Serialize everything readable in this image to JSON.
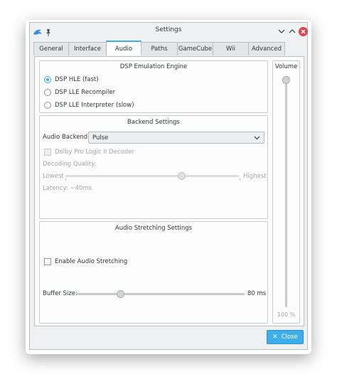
{
  "window": {
    "title": "Settings"
  },
  "tabs": [
    "General",
    "Interface",
    "Audio",
    "Paths",
    "GameCube",
    "Wii",
    "Advanced"
  ],
  "active_tab": "Audio",
  "dsp": {
    "title": "DSP Emulation Engine",
    "options": [
      "DSP HLE (fast)",
      "DSP LLE Recompiler",
      "DSP LLE Interpreter (slow)"
    ],
    "selected": "DSP HLE (fast)"
  },
  "volume": {
    "title": "Volume",
    "value_label": "100 %",
    "value_fraction": 1.0
  },
  "backend": {
    "title": "Backend Settings",
    "audio_backend_label": "Audio Backend:",
    "audio_backend_value": "Pulse",
    "dolby_label": "Dolby Pro Logic II Decoder",
    "decoding_quality_label": "Decoding Quality:",
    "lowest_label": "Lowest",
    "highest_label": "Highest",
    "decoding_quality_fraction": 0.67,
    "latency_label": "Latency: ~40ms"
  },
  "stretching": {
    "title": "Audio Stretching Settings",
    "enable_label": "Enable Audio Stretching",
    "enabled": false,
    "buffer_label": "Buffer Size:",
    "buffer_value": "80 ms",
    "buffer_fraction": 0.26
  },
  "footer": {
    "close_label": "Close"
  },
  "colors": {
    "accent": "#3daee9",
    "close_red": "#da4453",
    "window_bg": "#eff0f1"
  }
}
